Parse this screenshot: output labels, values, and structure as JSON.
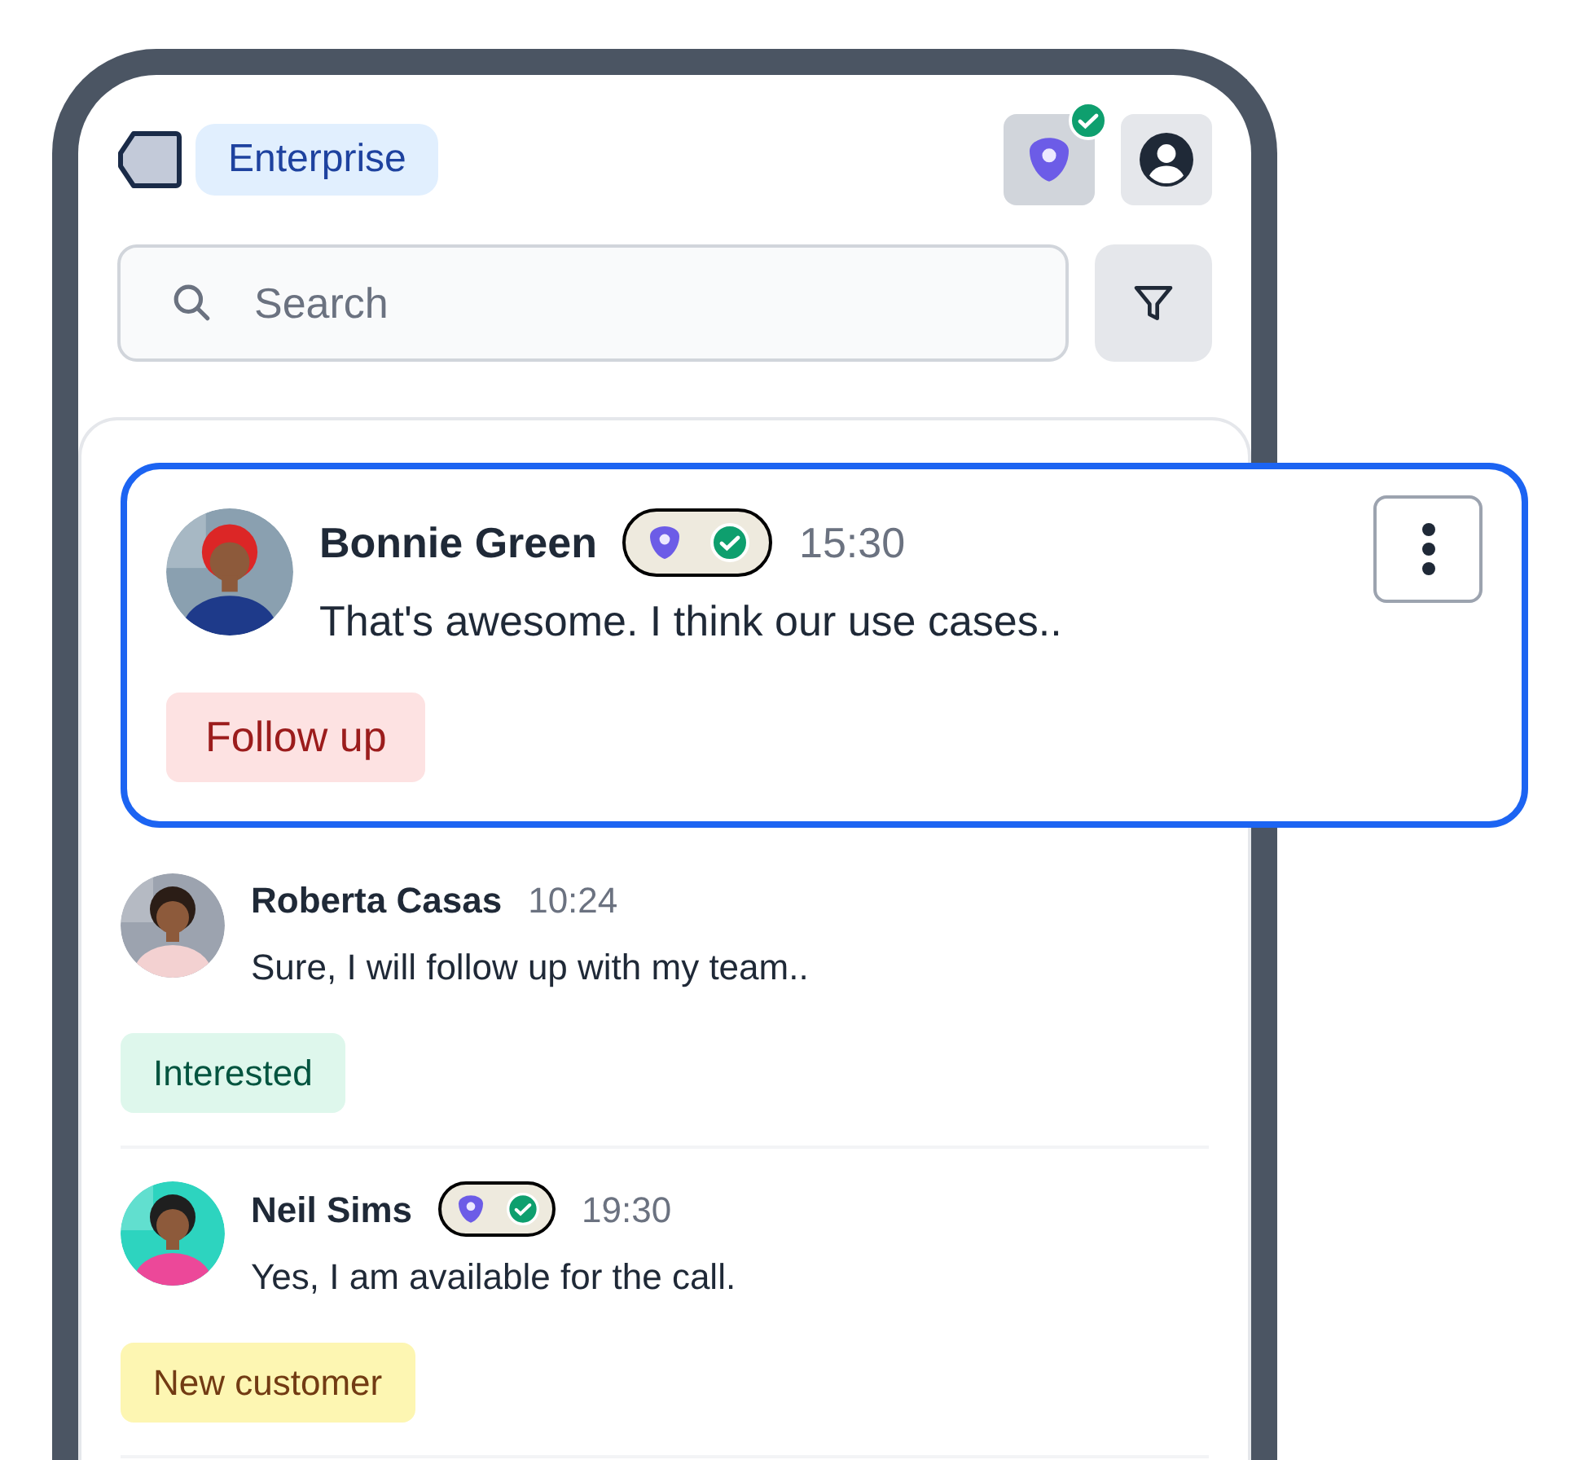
{
  "header": {
    "plan_badge": "Enterprise",
    "status_verified": true
  },
  "search": {
    "placeholder": "Search"
  },
  "conversations": [
    {
      "name": "Bonnie Green",
      "verified": true,
      "time": "15:30",
      "message": "That's awesome. I think our use cases..",
      "tag": "Follow up",
      "color": "#fde2e2",
      "selected": true
    },
    {
      "name": "Roberta Casas",
      "verified": false,
      "time": "10:24",
      "message": "Sure, I will follow up with my team..",
      "tag": "Interested",
      "color": "#def7ec",
      "selected": false
    },
    {
      "name": "Neil Sims",
      "verified": true,
      "time": "19:30",
      "message": "Yes, I am available for the call.",
      "tag": "New customer",
      "color": "#fdf6b2",
      "selected": false
    }
  ]
}
